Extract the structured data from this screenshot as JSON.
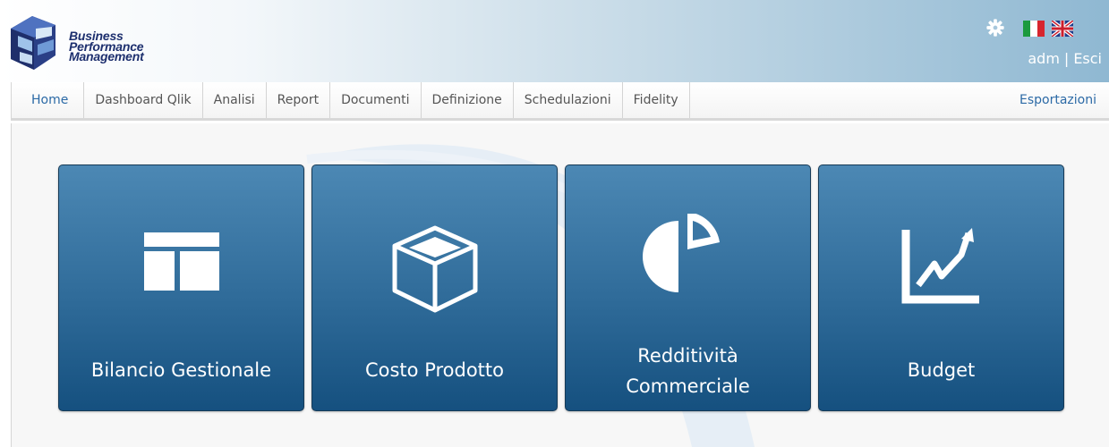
{
  "header": {
    "logo_lines": [
      "Business",
      "Performance",
      "Management"
    ],
    "user": "adm",
    "separator": "|",
    "logout_label": "Esci"
  },
  "nav": {
    "items": [
      "Home",
      "Dashboard Qlik",
      "Analisi",
      "Report",
      "Documenti",
      "Definizione",
      "Schedulazioni",
      "Fidelity"
    ],
    "active": "Home",
    "export_label": "Esportazioni"
  },
  "tiles": [
    {
      "label": "Bilancio Gestionale",
      "icon": "table-layout-icon"
    },
    {
      "label": "Costo Prodotto",
      "icon": "box-icon"
    },
    {
      "label_lines": [
        "Redditività",
        "Commerciale"
      ],
      "icon": "pie-chart-icon"
    },
    {
      "label": "Budget",
      "icon": "line-chart-icon"
    }
  ],
  "colors": {
    "accent": "#2c6aa6",
    "tile_top": "#4c88b4",
    "tile_bottom": "#15507f",
    "logo_text": "#1d2f6e"
  }
}
